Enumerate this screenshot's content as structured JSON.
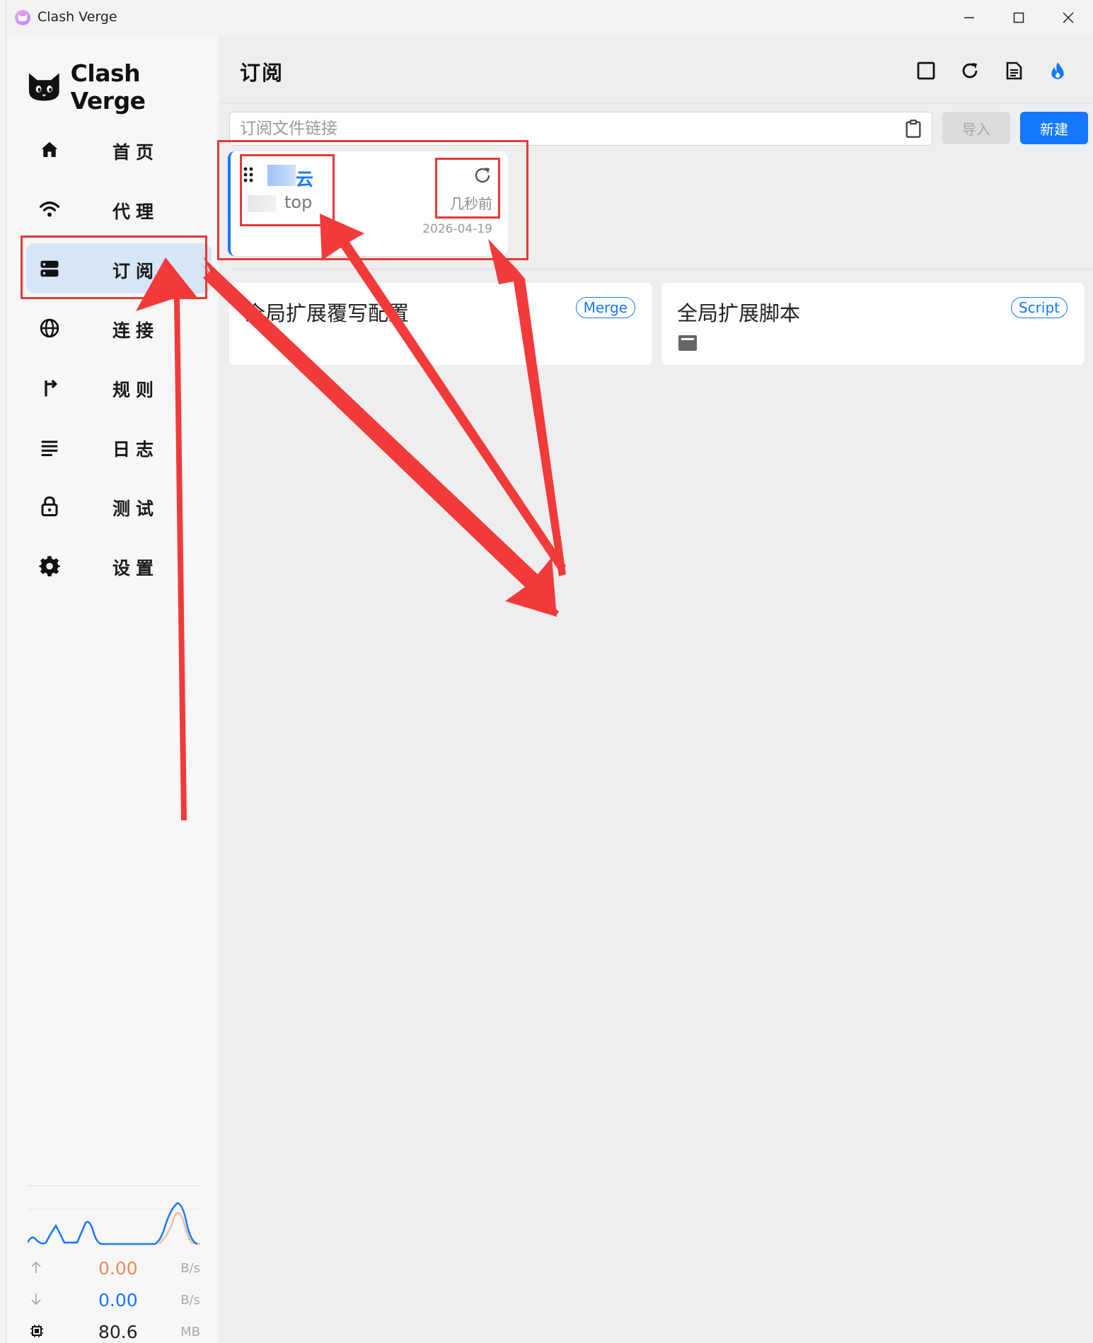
{
  "window": {
    "title": "Clash Verge"
  },
  "sidebar": {
    "logo_text": "Clash Verge",
    "items": [
      {
        "label": "首页",
        "icon": "home-icon"
      },
      {
        "label": "代理",
        "icon": "wifi-icon"
      },
      {
        "label": "订阅",
        "icon": "subscription-icon",
        "active": true
      },
      {
        "label": "连接",
        "icon": "globe-icon"
      },
      {
        "label": "规则",
        "icon": "fork-icon"
      },
      {
        "label": "日志",
        "icon": "list-icon"
      },
      {
        "label": "测试",
        "icon": "lock-icon"
      },
      {
        "label": "设置",
        "icon": "gear-icon"
      }
    ]
  },
  "traffic": {
    "upload": {
      "value": "0.00",
      "unit": "B/s",
      "color": "#f08a5d"
    },
    "download": {
      "value": "0.00",
      "unit": "B/s",
      "color": "#1677ff"
    },
    "memory": {
      "value": "80.6",
      "unit": "MB"
    }
  },
  "main": {
    "title": "订阅",
    "url_input": {
      "placeholder": "订阅文件链接",
      "value": ""
    },
    "import_label": "导入",
    "new_label": "新建",
    "profile": {
      "name": "云",
      "url_suffix": "top",
      "updated": "几秒前",
      "date": "2026-04-19"
    },
    "ext_cards": [
      {
        "title": "全局扩展覆写配置",
        "badge": "Merge"
      },
      {
        "title": "全局扩展脚本",
        "badge": "Script"
      }
    ]
  },
  "colors": {
    "accent": "#1677ff",
    "active_nav_bg": "#d7e6f7",
    "annotation": "#e53935"
  }
}
